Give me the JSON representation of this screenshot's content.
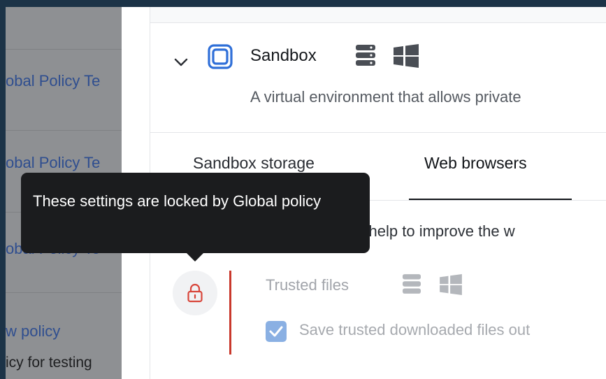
{
  "left_list": {
    "rows": [
      {
        "link": "obal Policy Te"
      },
      {
        "link": "obal Policy Te"
      },
      {
        "link": "obal Policy Te"
      },
      {
        "link": "w policy",
        "sub": "icy for testing"
      }
    ]
  },
  "section": {
    "title": "Sandbox",
    "description": "A virtual environment that allows private",
    "icons": [
      "chevron-down-icon",
      "sandbox-app-icon",
      "server-icon",
      "windows-icon"
    ]
  },
  "tabs": [
    {
      "label": "Sandbox storage",
      "active": false
    },
    {
      "label": "Web browsers",
      "active": true
    }
  ],
  "tab_description": "The settings below help to improve the w",
  "setting": {
    "title": "Trusted files",
    "checkbox_label": "Save trusted downloaded files out",
    "checked": true
  },
  "tooltip": {
    "text": "These settings are locked by Global policy"
  },
  "colors": {
    "frame": "#1c3347",
    "accent": "#2f6fd8",
    "lock_red": "#c9382c",
    "tooltip_bg": "#1b1c1e"
  }
}
